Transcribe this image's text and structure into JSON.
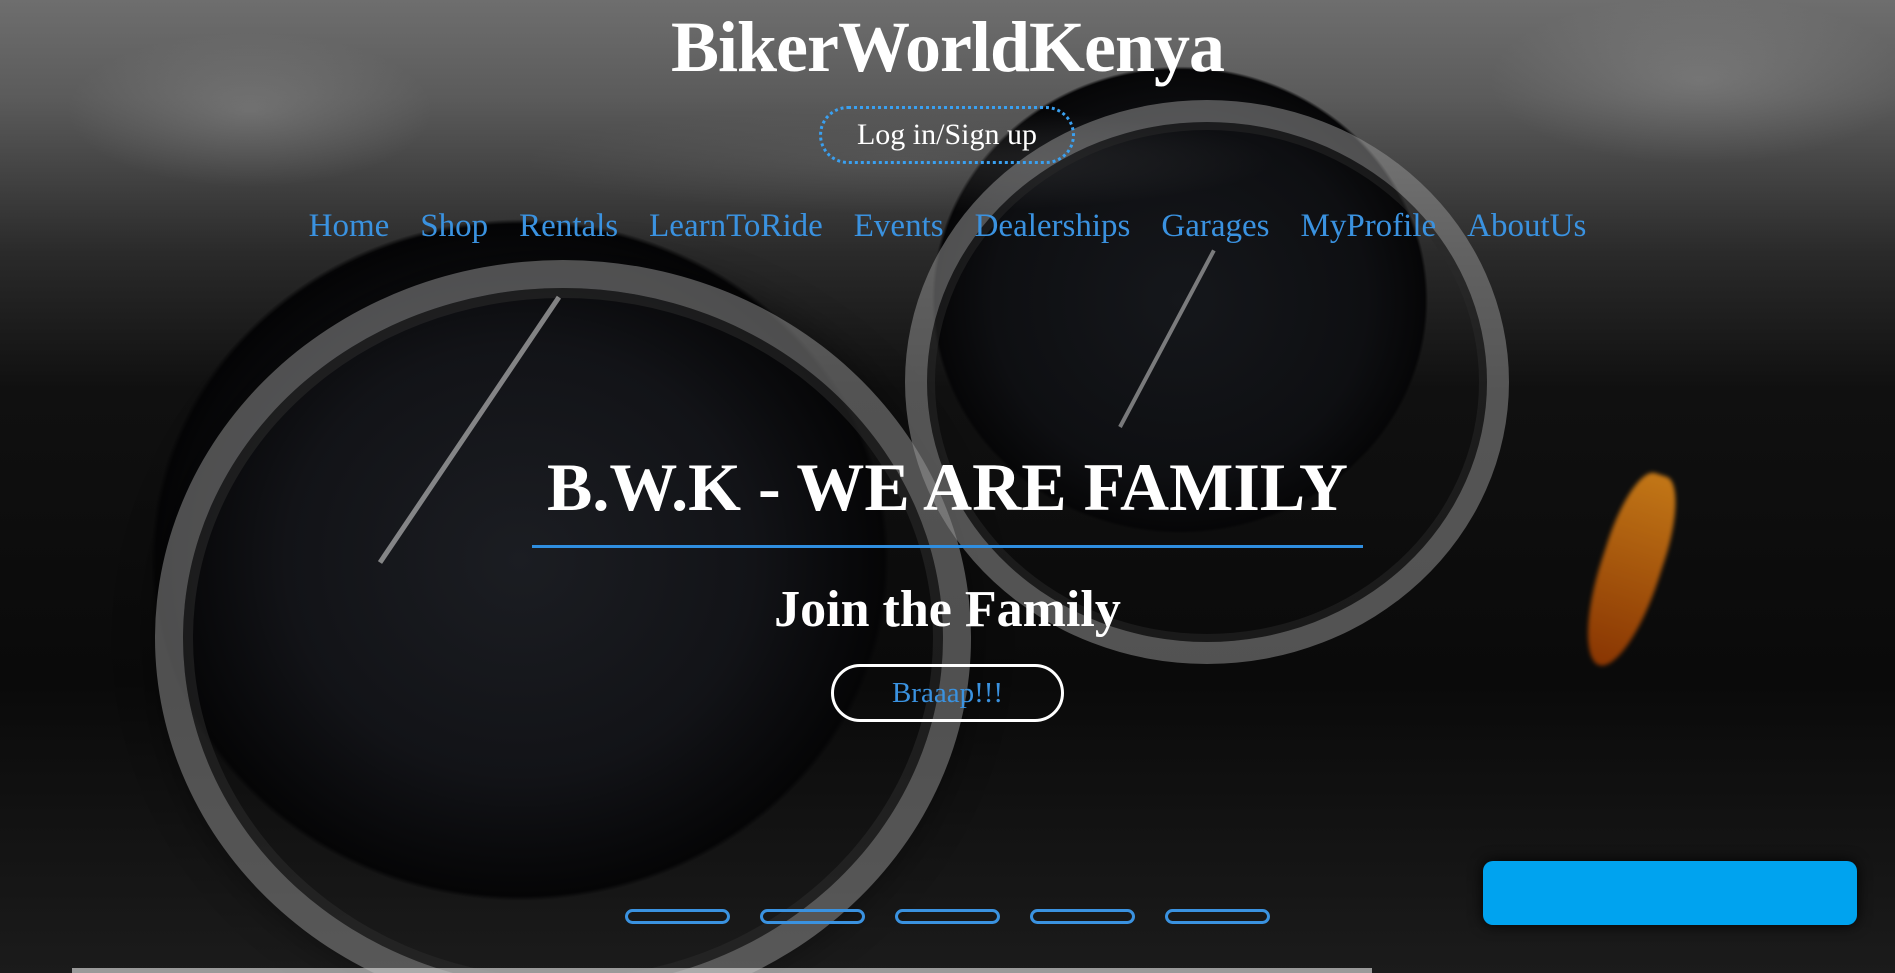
{
  "header": {
    "brand": "BikerWorldKenya",
    "login_label": "Log in/Sign up"
  },
  "nav": {
    "items": [
      {
        "label": "Home"
      },
      {
        "label": "Shop"
      },
      {
        "label": "Rentals"
      },
      {
        "label": "LearnToRide"
      },
      {
        "label": "Events"
      },
      {
        "label": "Dealerships"
      },
      {
        "label": "Garages"
      },
      {
        "label": "MyProfile"
      },
      {
        "label": "AboutUs"
      }
    ]
  },
  "hero": {
    "headline": "B.W.K - WE ARE FAMILY",
    "subheadline": "Join the Family",
    "cta_label": "Braaap!!!",
    "slide_count": 5
  },
  "colors": {
    "accent": "#3a92e0",
    "chat_widget": "#00a3ef",
    "text": "#ffffff"
  }
}
